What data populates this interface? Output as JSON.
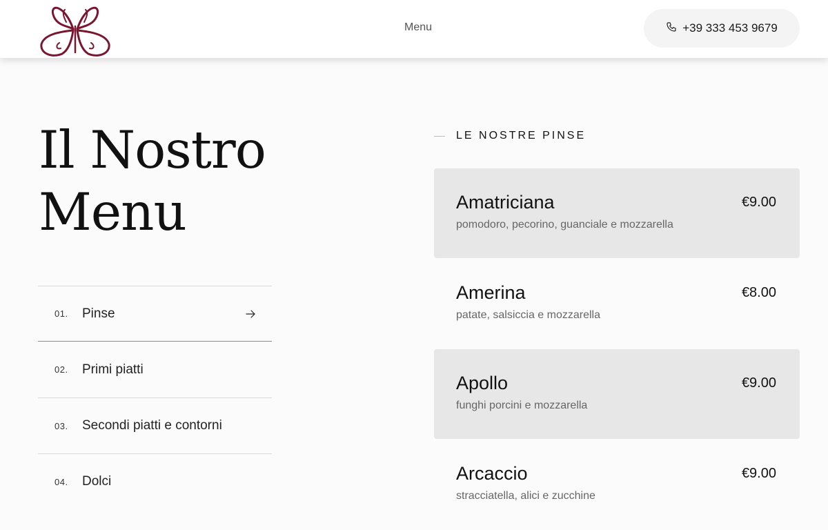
{
  "header": {
    "nav_menu": "Menu",
    "phone": "+39 333 453 9679",
    "brand_color": "#7a1530"
  },
  "page": {
    "title_line1": "Il Nostro",
    "title_line2": "Menu"
  },
  "categories": [
    {
      "num": "01.",
      "label": "Pinse",
      "active": true
    },
    {
      "num": "02.",
      "label": "Primi piatti",
      "active": false
    },
    {
      "num": "03.",
      "label": "Secondi piatti e contorni",
      "active": false
    },
    {
      "num": "04.",
      "label": "Dolci",
      "active": false
    }
  ],
  "section": {
    "title": "LE NOSTRE PINSE"
  },
  "dishes": [
    {
      "name": "Amatriciana",
      "desc": "pomodoro, pecorino, guanciale e mozzarella",
      "price": "€9.00"
    },
    {
      "name": "Amerina",
      "desc": "patate, salsiccia e mozzarella",
      "price": "€8.00"
    },
    {
      "name": "Apollo",
      "desc": "funghi porcini e mozzarella",
      "price": "€9.00"
    },
    {
      "name": "Arcaccio",
      "desc": "stracciatella, alici e zucchine",
      "price": "€9.00"
    }
  ]
}
